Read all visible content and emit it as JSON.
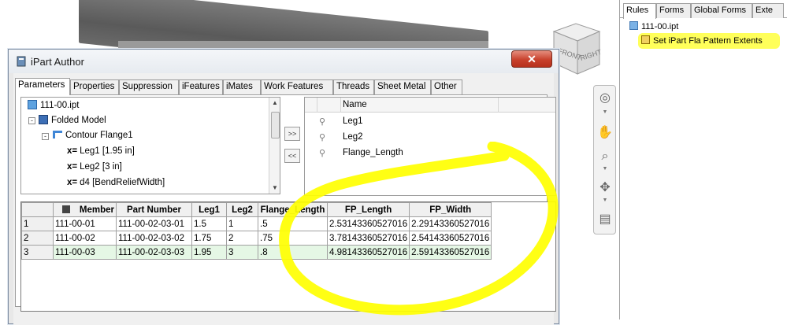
{
  "window": {
    "title": "iPart Author",
    "close_glyph": "✕"
  },
  "tabs": [
    "Parameters",
    "Properties",
    "Suppression",
    "iFeatures",
    "iMates",
    "Work Features",
    "Threads",
    "Sheet Metal",
    "Other"
  ],
  "tree": {
    "root": "111-00.ipt",
    "folded": "Folded Model",
    "flange": "Contour Flange1",
    "items": [
      "Leg1 [1.95 in]",
      "Leg2 [3 in]",
      "d4 [BendReliefWidth]"
    ],
    "x_prefix": "x="
  },
  "move_buttons": {
    "add": ">>",
    "remove": "<<"
  },
  "param_list": {
    "header": "Name",
    "items": [
      "Leg1",
      "Leg2",
      "Flange_Length"
    ]
  },
  "grid": {
    "headers": [
      "Member",
      "Part Number",
      "Leg1",
      "Leg2",
      "Flange_Length",
      "FP_Length",
      "FP_Width"
    ],
    "rows": [
      {
        "n": "1",
        "cells": [
          "111-00-01",
          "111-00-02-03-01",
          "1.5",
          "1",
          ".5",
          "2.53143360527016",
          "2.29143360527016"
        ]
      },
      {
        "n": "2",
        "cells": [
          "111-00-02",
          "111-00-02-03-02",
          "1.75",
          "2",
          ".75",
          "3.78143360527016",
          "2.54143360527016"
        ]
      },
      {
        "n": "3",
        "cells": [
          "111-00-03",
          "111-00-02-03-03",
          "1.95",
          "3",
          ".8",
          "4.98143360527016",
          "2.59143360527016"
        ]
      }
    ]
  },
  "rules_panel": {
    "tabs": [
      "Rules",
      "Forms",
      "Global Forms",
      "Exte"
    ],
    "root": "111-00.ipt",
    "rule": "Set iPart Fla Pattern Extents"
  },
  "viewcube": {
    "front": "FRONT",
    "right": "RIGHT"
  },
  "colors": {
    "highlight": "#ffff00",
    "selected_row": "#e5f7e5",
    "close_button": "#c8412c"
  }
}
